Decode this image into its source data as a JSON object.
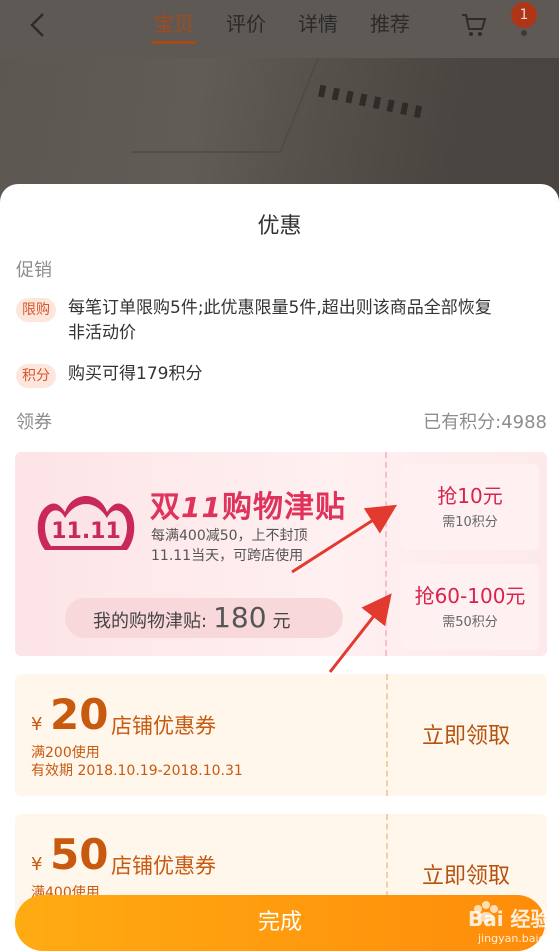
{
  "header": {
    "tabs": [
      {
        "label": "宝贝",
        "active": true
      },
      {
        "label": "评价",
        "active": false
      },
      {
        "label": "详情",
        "active": false
      },
      {
        "label": "推荐",
        "active": false
      }
    ],
    "cart_badge": "1",
    "icons": {
      "back": "back-chevron-icon",
      "cart": "cart-icon"
    }
  },
  "sheet": {
    "title": "优惠",
    "promotion": {
      "label": "促销",
      "items": [
        {
          "tag": "限购",
          "text_line1": "每笔订单限购5件;此优惠限量5件,超出则该商品全部恢复",
          "text_line2": "非活动价"
        },
        {
          "tag": "积分",
          "text_line1": "购买可得179积分"
        }
      ]
    },
    "coupons_section": {
      "label": "领券",
      "points_owned": "已有积分:4988"
    },
    "subsidy": {
      "logo_text": "11.11",
      "title_prefix": "双",
      "title_mark": "11",
      "title_suffix": "购物津贴",
      "desc_line1": "每满400减50，上不封顶",
      "desc_line2": "11.11当天，可跨店使用",
      "mine_label": "我的购物津贴:",
      "mine_amount": "180",
      "mine_unit": "元",
      "grab_options": [
        {
          "main": "抢10元",
          "sub": "需10积分"
        },
        {
          "main": "抢60-100元",
          "sub": "需50积分"
        }
      ]
    },
    "shop_coupons": [
      {
        "yen": "¥",
        "value": "20",
        "title": "店铺优惠券",
        "condition": "满200使用",
        "validity": "有效期 2018.10.19-2018.10.31",
        "action": "立即领取"
      },
      {
        "yen": "¥",
        "value": "50",
        "title": "店铺优惠券",
        "condition": "满400使用",
        "validity": "",
        "action": "立即领取"
      }
    ]
  },
  "footer": {
    "done_label": "完成"
  },
  "watermark": {
    "brand": "Bai 经验",
    "url": "jingyan.baidu.com"
  },
  "colors": {
    "accent_orange": "#ff9a0e",
    "promo_red": "#e0335b",
    "coupon_brown": "#c85a10",
    "annotation_red": "#e23a2e"
  }
}
